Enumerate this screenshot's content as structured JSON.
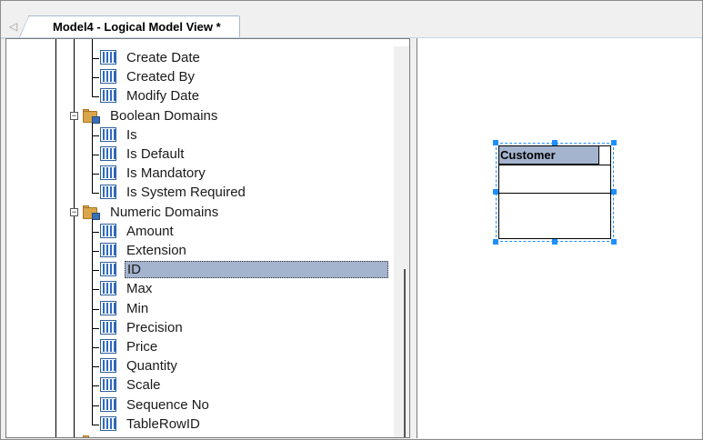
{
  "tab": {
    "title": "Model4 - Logical Model View *",
    "scroll_left_glyph": "◁"
  },
  "tree": {
    "items": [
      {
        "label": "Create Date",
        "kind": "column"
      },
      {
        "label": "Created By",
        "kind": "column"
      },
      {
        "label": "Modify Date",
        "kind": "column"
      },
      {
        "label": "Boolean Domains",
        "kind": "folder",
        "expanded": true
      },
      {
        "label": "Is",
        "kind": "column"
      },
      {
        "label": "Is Default",
        "kind": "column"
      },
      {
        "label": "Is Mandatory",
        "kind": "column"
      },
      {
        "label": "Is System Required",
        "kind": "column"
      },
      {
        "label": "Numeric Domains",
        "kind": "folder",
        "expanded": true
      },
      {
        "label": "Amount",
        "kind": "column"
      },
      {
        "label": "Extension",
        "kind": "column"
      },
      {
        "label": "ID",
        "kind": "column",
        "selected": true
      },
      {
        "label": "Max",
        "kind": "column"
      },
      {
        "label": "Min",
        "kind": "column"
      },
      {
        "label": "Precision",
        "kind": "column"
      },
      {
        "label": "Price",
        "kind": "column"
      },
      {
        "label": "Quantity",
        "kind": "column"
      },
      {
        "label": "Scale",
        "kind": "column"
      },
      {
        "label": "Sequence No",
        "kind": "column"
      },
      {
        "label": "TableRowID",
        "kind": "column"
      }
    ],
    "expander_glyph": "−"
  },
  "diagram": {
    "entity_name": "Customer",
    "selection_color": "#1e90ff",
    "title_color": "#a4b4ce"
  },
  "icons": {
    "column": "column-icon",
    "folder": "domain-folder-icon",
    "expander": "collapse-icon"
  }
}
